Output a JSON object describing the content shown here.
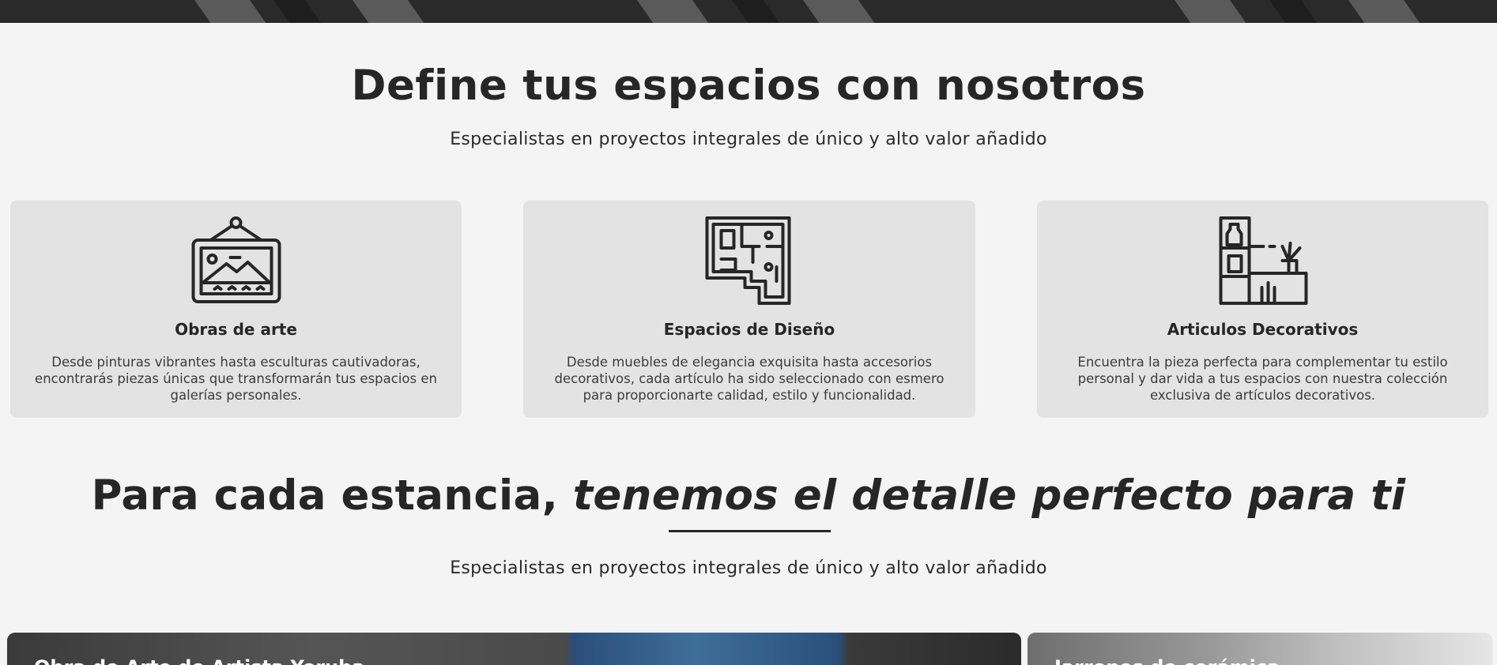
{
  "hero": {
    "icon": "hero-image-strip"
  },
  "section1": {
    "title": "Define tus espacios con nosotros",
    "subtitle": "Especialistas en proyectos integrales de único y alto valor añadido",
    "cards": [
      {
        "icon": "framed-picture-icon",
        "title": "Obras de arte",
        "text": "Desde pinturas vibrantes hasta esculturas cautivadoras, encontrarás piezas únicas que transformarán tus espacios en galerías personales."
      },
      {
        "icon": "floor-plan-icon",
        "title": "Espacios de Diseño",
        "text": "Desde muebles de elegancia exquisita hasta accesorios decorativos, cada artículo ha sido seleccionado con esmero para proporcionarte calidad, estilo y funcionalidad."
      },
      {
        "icon": "shelf-decor-icon",
        "title": "Articulos Decorativos",
        "text": "Encuentra la pieza perfecta para complementar tu estilo personal y dar vida a tus espacios con nuestra colección exclusiva de artículos decorativos."
      }
    ]
  },
  "section2": {
    "title_plain": "Para cada estancia, ",
    "title_italic": "tenemos el detalle perfecto para ti",
    "subtitle": "Especialistas en proyectos integrales de único y alto valor añadido"
  },
  "gallery": [
    {
      "label": "Obra de Arte de Artista Yoruba"
    },
    {
      "label": "Jarrones de cerámica"
    }
  ],
  "colors": {
    "background": "#f4f4f4",
    "card": "#e3e3e3",
    "text": "#262626"
  }
}
